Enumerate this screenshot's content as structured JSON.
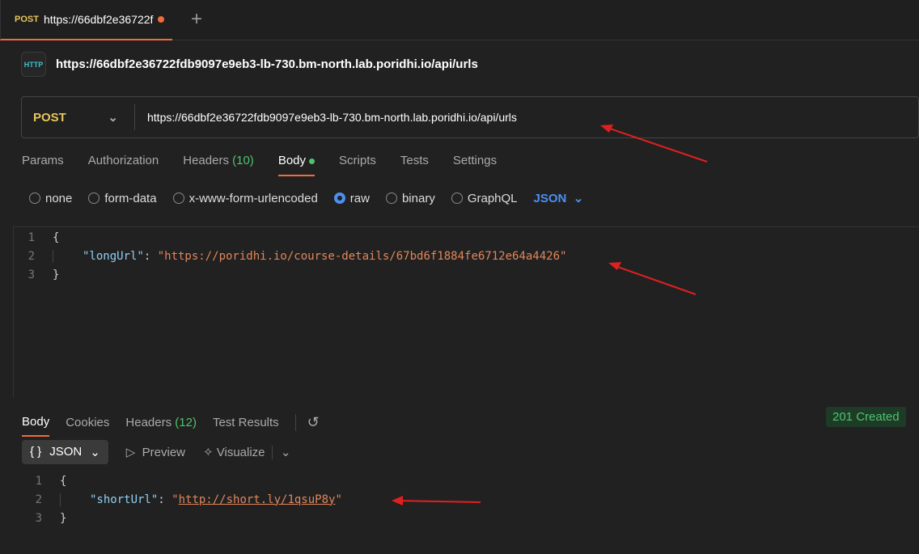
{
  "tab": {
    "method": "POST",
    "title": "https://66dbf2e36722f",
    "unsaved_color": "#f26b3a"
  },
  "header": {
    "icon": "http-icon",
    "title": "https://66dbf2e36722fdb9097e9eb3-lb-730.bm-north.lab.poridhi.io/api/urls"
  },
  "request": {
    "method": "POST",
    "url": "https://66dbf2e36722fdb9097e9eb3-lb-730.bm-north.lab.poridhi.io/api/urls"
  },
  "req_tabs": {
    "params": "Params",
    "authorization": "Authorization",
    "headers": "Headers",
    "headers_count": "(10)",
    "body": "Body",
    "scripts": "Scripts",
    "tests": "Tests",
    "settings": "Settings"
  },
  "body_types": {
    "none": "none",
    "form_data": "form-data",
    "urlencoded": "x-www-form-urlencoded",
    "raw": "raw",
    "binary": "binary",
    "graphql": "GraphQL",
    "format": "JSON",
    "selected": "raw"
  },
  "request_body": {
    "l1": "{",
    "key": "\"longUrl\"",
    "colon": ": ",
    "value": "\"https://poridhi.io/course-details/67bd6f1884fe6712e64a4426\"",
    "l3": "}"
  },
  "res_tabs": {
    "body": "Body",
    "cookies": "Cookies",
    "headers": "Headers",
    "headers_count": "(12)",
    "test_results": "Test Results"
  },
  "status": "201 Created",
  "res_toolbar": {
    "format": "JSON",
    "preview": "Preview",
    "visualize": "Visualize"
  },
  "response_body": {
    "l1": "{",
    "key": "\"shortUrl\"",
    "colon": ": ",
    "q": "\"",
    "value": "http://short.ly/1qsuP8y",
    "l3": "}"
  },
  "accent": "#f26b3a"
}
